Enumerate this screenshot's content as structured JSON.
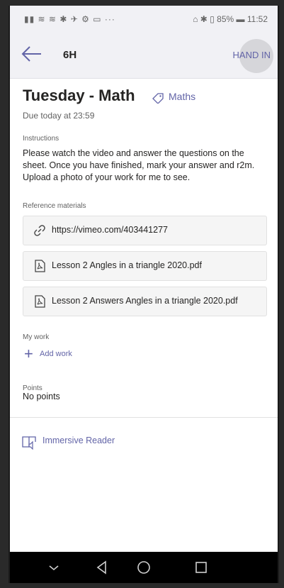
{
  "status_bar": {
    "left_icons": "signal wifi wifi bluetooth-sat twitter gear calendar ...",
    "right_text": "85%",
    "time": "11:52"
  },
  "header": {
    "class_name": "6H",
    "hand_in_label": "HAND IN"
  },
  "assignment": {
    "title": "Tuesday - Math",
    "tag_label": "Maths",
    "due": "Due today at 23:59"
  },
  "instructions": {
    "label": "Instructions",
    "text": "Please watch the video and answer the questions on the sheet. Once you have finished, mark your answer and r2m. Upload a photo of your work for me to see."
  },
  "reference_materials": {
    "label": "Reference materials",
    "items": [
      {
        "icon": "link-icon",
        "label": "https://vimeo.com/403441277"
      },
      {
        "icon": "pdf-icon",
        "label": "Lesson 2 Angles in a triangle 2020.pdf"
      },
      {
        "icon": "pdf-icon",
        "label": "Lesson 2 Answers Angles in a triangle 2020.pdf"
      }
    ]
  },
  "my_work": {
    "label": "My work",
    "add_label": "Add work"
  },
  "points": {
    "label": "Points",
    "value": "No points"
  },
  "immersive_reader": {
    "label": "Immersive Reader"
  },
  "colors": {
    "accent": "#6264a7",
    "header_bg": "#f1f1f5",
    "nav_bg": "#000000"
  }
}
